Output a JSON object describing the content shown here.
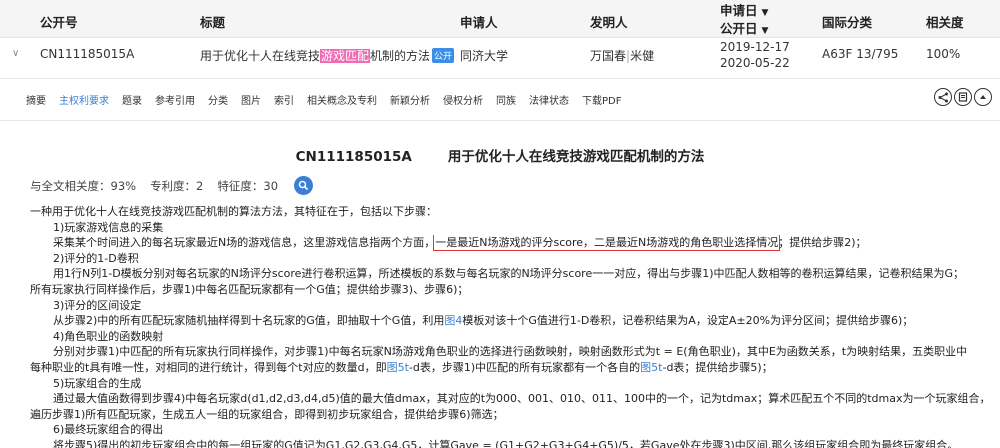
{
  "header": {
    "pub_no": "公开号",
    "title": "标题",
    "applicant": "申请人",
    "inventor": "发明人",
    "app_date": "申请日",
    "pub_date": "公开日",
    "ipc": "国际分类",
    "relevance": "相关度"
  },
  "result": {
    "pub_no": "CN111185015A",
    "title_pre": "用于优化十人在线竞技",
    "title_hl": "游戏匹配",
    "title_post": "机制的方法",
    "badge": "公开",
    "applicant": "同济大学",
    "inventor_1": "万国春",
    "inventor_sep": "|",
    "inventor_2": "米健",
    "app_date": "2019-12-17",
    "pub_date": "2020-05-22",
    "ipc": "A63F 13/795",
    "relevance": "100%"
  },
  "tabs": [
    "摘要",
    "主权利要求",
    "题录",
    "参考引用",
    "分类",
    "图片",
    "索引",
    "相关概念及专利",
    "新颖分析",
    "侵权分析",
    "同族",
    "法律状态",
    "下载PDF"
  ],
  "active_tab": "主权利要求",
  "doc": {
    "pub_no": "CN111185015A",
    "title": "用于优化十人在线竞技游戏匹配机制的方法",
    "relevance": "与全文相关度：93%",
    "claim_rel": "专利度：2",
    "feature_rel": "特征度：30"
  },
  "claims": {
    "l01": "一种用于优化十人在线竞技游戏匹配机制的算法方法，其特征在于，包括以下步骤：",
    "l02": "1)玩家游戏信息的采集",
    "l03a": "采集某个时间进入的每名玩家最近N场的游戏信息，这里游戏信息指两个方面，",
    "l03b": "一是最近N场游戏的评分score，二是最近N场游戏的角色职业选择情况",
    "l03c": "；提供给步骤2)；",
    "l04": "2)评分的1-D卷积",
    "l05": "用1行N列1-D模板分别对每名玩家的N场评分score进行卷积运算，所述模板的系数与每名玩家的N场评分score一一对应，得出与步骤1)中匹配人数相等的卷积运算结果，记卷积结果为G；",
    "l06": "所有玩家执行同样操作后，步骤1)中每名匹配玩家都有一个G值；提供给步骤3)、步骤6)；",
    "l07": "3)评分的区间设定",
    "l08a": "从步骤2)中的所有匹配玩家随机抽样得到十名玩家的G值，即抽取十个G值，利用",
    "l08b": "图4",
    "l08c": "模板对该十个G值进行1-D卷积，记卷积结果为A，设定A±20%为评分区间；提供给步骤6)；",
    "l09": "4)角色职业的函数映射",
    "l10": "分别对步骤1)中匹配的所有玩家执行同样操作，对步骤1)中每名玩家N场游戏角色职业的选择进行函数映射，映射函数形式为t = E(角色职业)，其中E为函数关系，t为映射结果，五类职业中",
    "l11a": "每种职业的t具有唯一性，对相同的进行统计，得到每个t对应的数量d，即",
    "l11b": "图5t",
    "l11c": "-d表，步骤1)中匹配的所有玩家都有一个各自的",
    "l11d": "图5t",
    "l11e": "-d表；提供给步骤5)；",
    "l12": "5)玩家组合的生成",
    "l13": "通过最大值函数得到步骤4)中每名玩家d(d1,d2,d3,d4,d5)值的最大值dmax，其对应的t为000、001、010、011、100中的一个，记为tdmax；算术匹配五个不同的tdmax为一个玩家组合，",
    "l14": "遍历步骤1)所有匹配玩家，生成五人一组的玩家组合，即得到初步玩家组合，提供给步骤6)筛选；",
    "l15": "6)最终玩家组合的得出",
    "l16": "将步骤5)得出的初步玩家组合中的每一组玩家的G值记为G1,G2,G3,G4,G5，计算Gave = (G1+G2+G3+G4+G5)/5，若Gave处在步骤3)中区间,那么该组玩家组合即为最终玩家组合。"
  },
  "colors": {
    "link": "#3a7fd5",
    "pub_no": "#d6336c",
    "highlight": "#f06ab4",
    "redbox": "#e03131"
  }
}
